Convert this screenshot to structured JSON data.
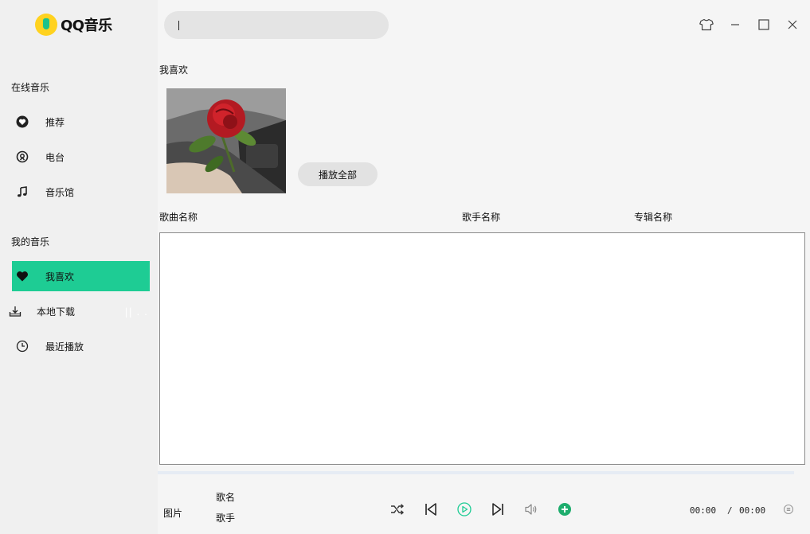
{
  "app": {
    "name": "QQ音乐"
  },
  "sidebar": {
    "online_title": "在线音乐",
    "online_items": [
      {
        "label": "推荐",
        "icon": "heart-circle-icon"
      },
      {
        "label": "电台",
        "icon": "radio-icon"
      },
      {
        "label": "音乐馆",
        "icon": "music-note-icon"
      }
    ],
    "my_title": "我的音乐",
    "my_items": [
      {
        "label": "我喜欢",
        "icon": "heart-icon",
        "active": true
      },
      {
        "label": "本地下载",
        "icon": "download-icon",
        "indicator": "|| . ."
      },
      {
        "label": "最近播放",
        "icon": "clock-icon"
      }
    ],
    "accent_color": "#1ecc94"
  },
  "search": {
    "value": "",
    "placeholder": ""
  },
  "window_controls": [
    "skin-icon",
    "minimize-icon",
    "maximize-icon",
    "close-icon"
  ],
  "playlist": {
    "title": "我喜欢",
    "play_all_label": "播放全部",
    "columns": [
      "歌曲名称",
      "歌手名称",
      "专辑名称"
    ],
    "rows": []
  },
  "player": {
    "picture_label": "图片",
    "song_name": "歌名",
    "artist": "歌手",
    "progress": 0,
    "current_time": "00:00",
    "separator": "/",
    "total_time": "00:00"
  }
}
